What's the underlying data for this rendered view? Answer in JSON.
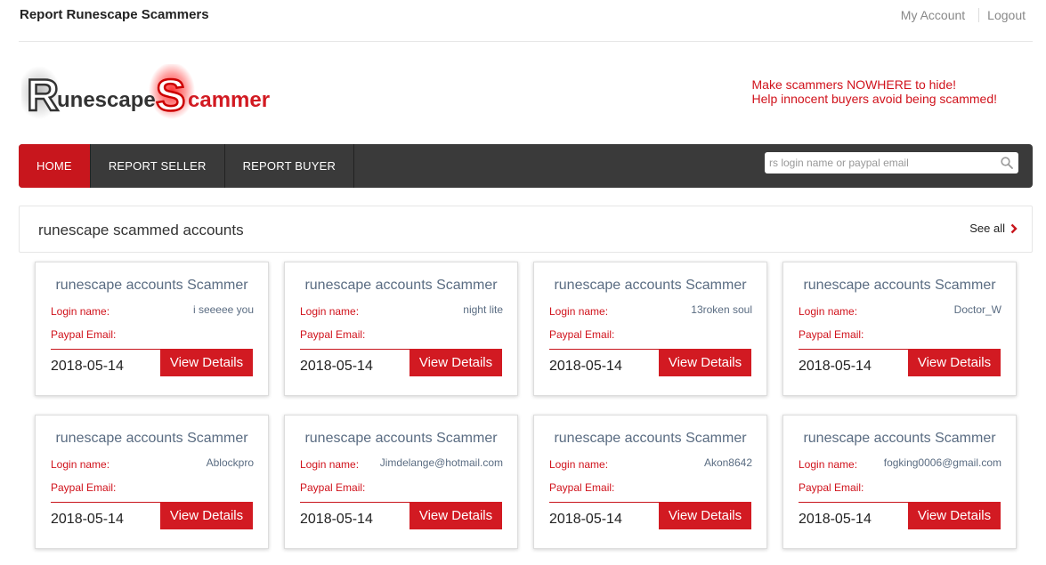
{
  "header": {
    "site_title": "Report Runescape Scammers",
    "my_account": "My Account",
    "logout": "Logout"
  },
  "logo": {
    "text_part1_initial": "R",
    "text_part1": "unescape",
    "text_part2_initial": "S",
    "text_part2": "cammer"
  },
  "slogan": {
    "line1": "Make scammers NOWHERE to hide!",
    "line2": "Help innocent buyers avoid being scammed!"
  },
  "nav": {
    "items": [
      {
        "label": "HOME",
        "active": true
      },
      {
        "label": "REPORT SELLER",
        "active": false
      },
      {
        "label": "REPORT BUYER",
        "active": false
      }
    ]
  },
  "search": {
    "placeholder": "rs login name or paypal email",
    "icon": "search-icon"
  },
  "section": {
    "title": "runescape scammed accounts",
    "see_all": "See all"
  },
  "card_labels": {
    "login": "Login name:",
    "paypal": "Paypal Email:",
    "button": "View Details"
  },
  "cards": [
    {
      "title": "runescape accounts Scammer",
      "login": "i seeeee you",
      "paypal": "",
      "date": "2018-05-14"
    },
    {
      "title": "runescape accounts Scammer",
      "login": "night lite",
      "paypal": "",
      "date": "2018-05-14"
    },
    {
      "title": "runescape accounts Scammer",
      "login": "13roken soul",
      "paypal": "",
      "date": "2018-05-14"
    },
    {
      "title": "runescape accounts Scammer",
      "login": "Doctor_W",
      "paypal": "",
      "date": "2018-05-14"
    },
    {
      "title": "runescape accounts Scammer",
      "login": "Ablockpro",
      "paypal": "",
      "date": "2018-05-14"
    },
    {
      "title": "runescape accounts Scammer",
      "login": "Jimdelange@hotmail.com",
      "paypal": "",
      "date": "2018-05-14"
    },
    {
      "title": "runescape accounts Scammer",
      "login": "Akon8642",
      "paypal": "",
      "date": "2018-05-14"
    },
    {
      "title": "runescape accounts Scammer",
      "login": "fogking0006@gmail.com",
      "paypal": "",
      "date": "2018-05-14"
    }
  ],
  "colors": {
    "accent": "#c8161d",
    "nav_bg": "#3a3a3a",
    "label_red": "#d0121b",
    "value_gray": "#5a6c82"
  }
}
